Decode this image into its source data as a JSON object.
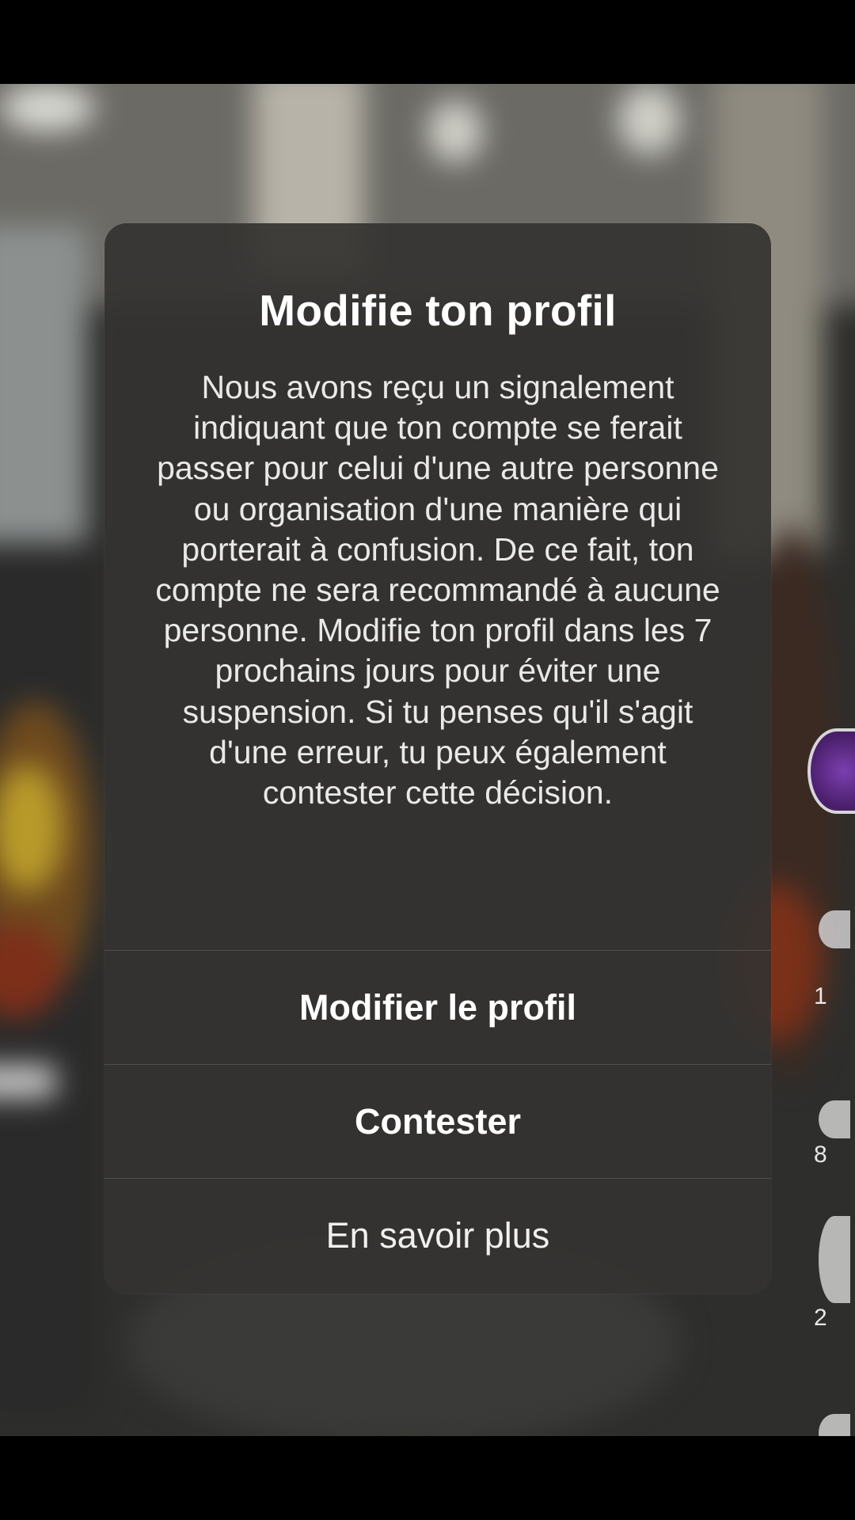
{
  "dialog": {
    "title": "Modifie ton profil",
    "message": "Nous avons reçu un signalement indiquant que ton compte se ferait passer pour celui d'une autre personne ou organisation d'une manière qui porterait à confusion. De ce fait, ton compte ne sera recommandé à aucune personne. Modifie ton profil dans les 7 prochains jours pour éviter une suspension. Si tu penses qu'il s'agit d'une erreur, tu peux également contester cette décision.",
    "buttons": {
      "edit_profile": "Modifier le profil",
      "contest": "Contester",
      "learn_more": "En savoir plus"
    }
  },
  "side_rail": {
    "counts": [
      "1",
      "8",
      "2"
    ]
  },
  "colors": {
    "dialog_background": "#343331",
    "text": "#ffffff",
    "divider": "#4a4947",
    "avatar_accent": "#7b3fb0"
  }
}
